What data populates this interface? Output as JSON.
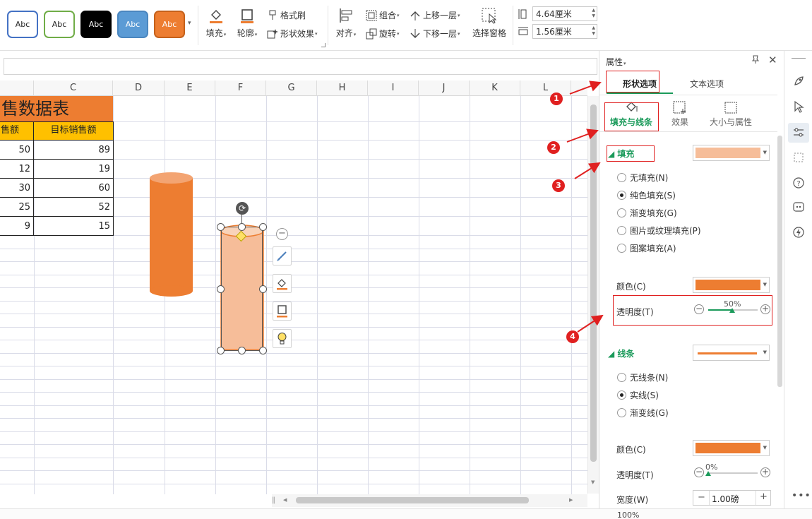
{
  "ribbon": {
    "styles": [
      {
        "label": "Abc",
        "fg": "#222222",
        "bg": "#ffffff",
        "border": "#4472c4"
      },
      {
        "label": "Abc",
        "fg": "#222222",
        "bg": "#ffffff",
        "border": "#70ad47"
      },
      {
        "label": "Abc",
        "fg": "#ffffff",
        "bg": "#000000",
        "border": "#000000"
      },
      {
        "label": "Abc",
        "fg": "#ffffff",
        "bg": "#5b9bd5",
        "border": "#4a86bf"
      },
      {
        "label": "Abc",
        "fg": "#ffffff",
        "bg": "#ed7d31",
        "border": "#c5611b"
      }
    ],
    "fill": "填充",
    "outline": "轮廓",
    "format_painter": "格式刷",
    "shape_effects": "形状效果",
    "align": "对齐",
    "group": "组合",
    "rotate": "旋转",
    "bring_forward": "上移一层",
    "send_backward": "下移一层",
    "selection_pane": "选择窗格",
    "height_value": "4.64厘米",
    "width_value": "1.56厘米"
  },
  "sheet": {
    "columns": [
      "C",
      "D",
      "E",
      "F",
      "G",
      "H",
      "I",
      "J",
      "K",
      "L"
    ],
    "title": "售数据表",
    "header_left": "售额",
    "header_right": "目标销售额",
    "rows": [
      {
        "a": "50",
        "b": "89"
      },
      {
        "a": "12",
        "b": "19"
      },
      {
        "a": "30",
        "b": "60"
      },
      {
        "a": "25",
        "b": "52"
      },
      {
        "a": "9",
        "b": "15"
      }
    ]
  },
  "pane": {
    "title": "属性",
    "tab_shape": "形状选项",
    "tab_text": "文本选项",
    "sub_fill_line": "填充与线条",
    "sub_effects": "效果",
    "sub_size": "大小与属性",
    "fill_section": "填充",
    "fill_options": [
      {
        "label": "无填充(N)",
        "selected": false
      },
      {
        "label": "纯色填充(S)",
        "selected": true
      },
      {
        "label": "渐变填充(G)",
        "selected": false
      },
      {
        "label": "图片或纹理填充(P)",
        "selected": false
      },
      {
        "label": "图案填充(A)",
        "selected": false
      }
    ],
    "fill_swatch": "#f6bd99",
    "color_label": "颜色(C)",
    "fill_color": "#ed7d31",
    "transparency_label": "透明度(T)",
    "fill_transparency": "50%",
    "line_section": "线条",
    "line_options": [
      {
        "label": "无线条(N)",
        "selected": false
      },
      {
        "label": "实线(S)",
        "selected": true
      },
      {
        "label": "渐变线(G)",
        "selected": false
      }
    ],
    "line_color_label": "颜色(C)",
    "line_color": "#ed7d31",
    "line_transparency_label": "透明度(T)",
    "line_transparency": "0%",
    "width_label": "宽度(W)",
    "width_value": "1.00磅"
  },
  "status": {
    "zoom": "100%"
  },
  "annotations": [
    "1",
    "2",
    "3",
    "4"
  ],
  "colors": {
    "accent_green": "#1a9a5a",
    "shape_orange": "#ed7d31",
    "annotation_red": "#e02020"
  }
}
